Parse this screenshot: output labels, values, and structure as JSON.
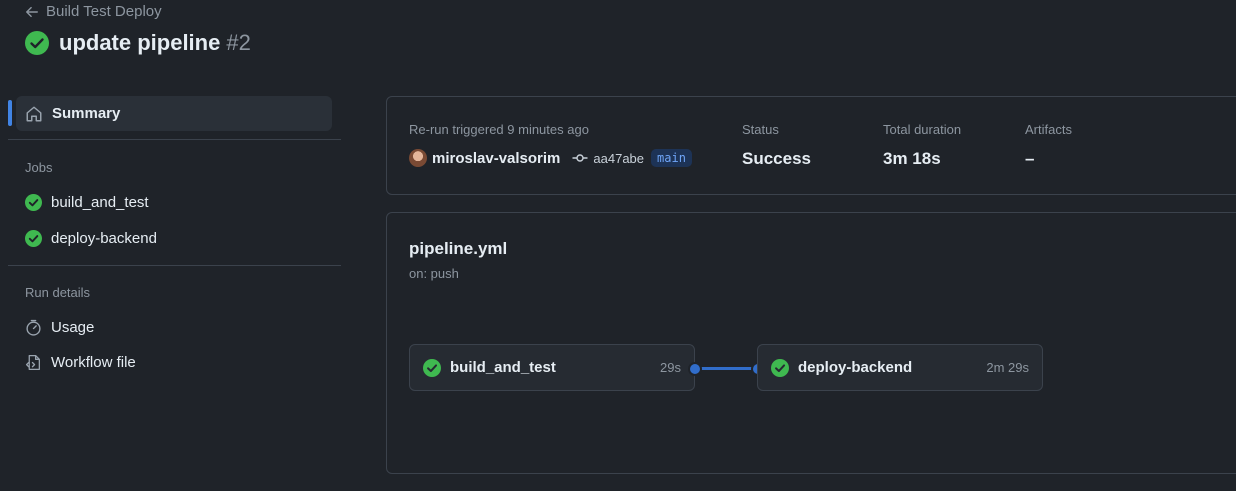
{
  "header": {
    "back_label": "Build Test Deploy",
    "title": "update pipeline",
    "run_number": "#2"
  },
  "sidebar": {
    "summary_label": "Summary",
    "jobs_heading": "Jobs",
    "jobs": [
      {
        "label": "build_and_test",
        "status": "success"
      },
      {
        "label": "deploy-backend",
        "status": "success"
      }
    ],
    "run_details_heading": "Run details",
    "details": [
      {
        "label": "Usage",
        "icon": "stopwatch-icon"
      },
      {
        "label": "Workflow file",
        "icon": "file-code-icon"
      }
    ]
  },
  "summary_card": {
    "trigger_label": "Re-run triggered 9 minutes ago",
    "actor": "miroslav-valsorim",
    "commit": "aa47abe",
    "branch": "main",
    "status_label": "Status",
    "status_value": "Success",
    "duration_label": "Total duration",
    "duration_value": "3m 18s",
    "artifacts_label": "Artifacts",
    "artifacts_value": "–"
  },
  "workflow_card": {
    "file_name": "pipeline.yml",
    "trigger": "on: push",
    "nodes": [
      {
        "name": "build_and_test",
        "duration": "29s"
      },
      {
        "name": "deploy-backend",
        "duration": "2m 29s"
      }
    ]
  },
  "colors": {
    "success": "#3fb950",
    "accent": "#4184e4",
    "background": "#1f2329"
  }
}
